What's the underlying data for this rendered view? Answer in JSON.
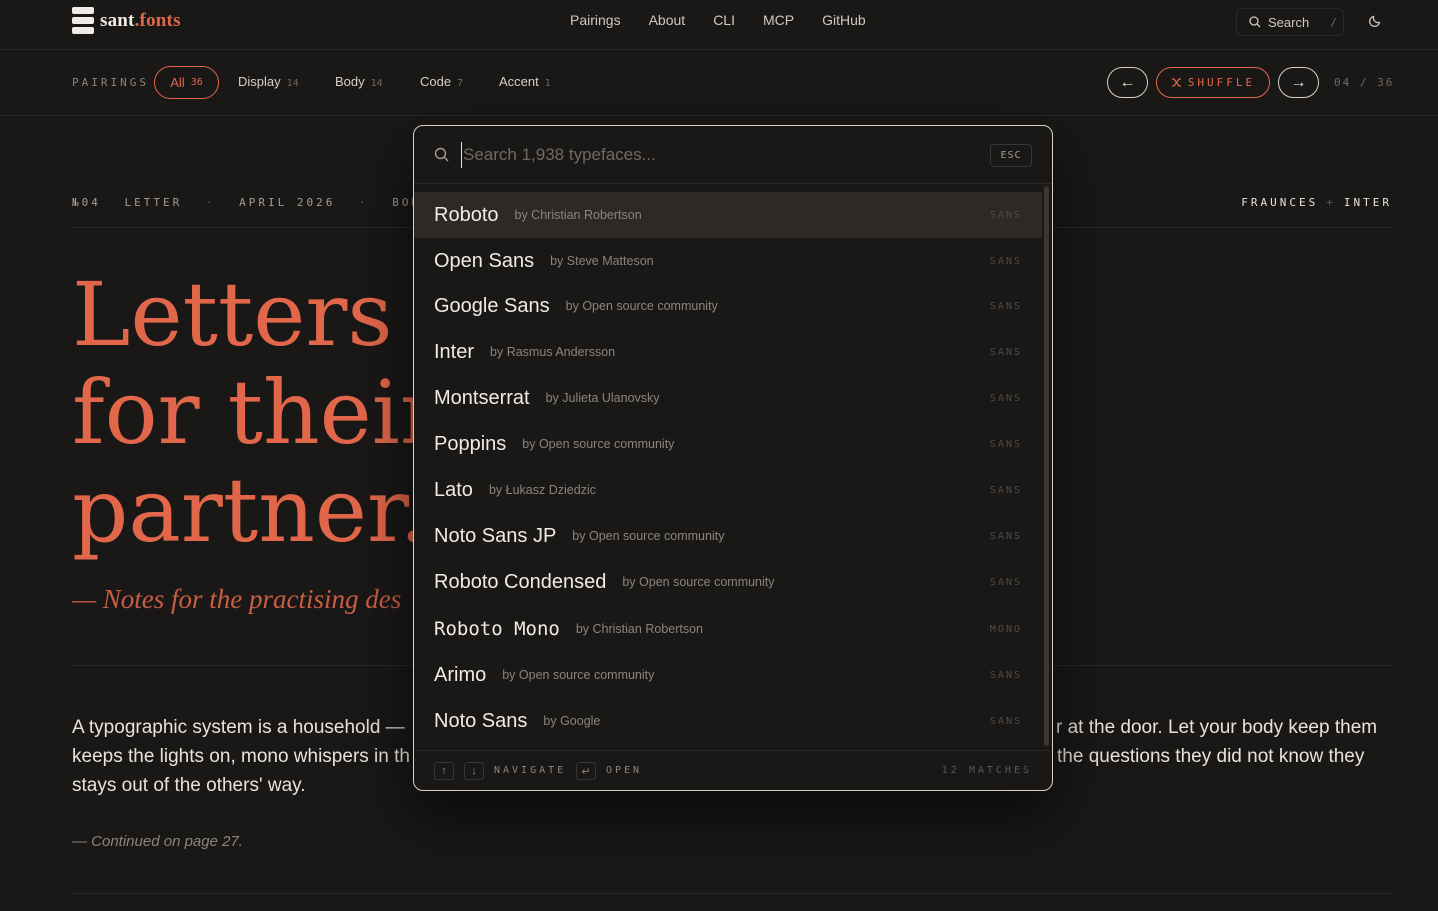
{
  "brand": {
    "name_main": "sant",
    "name_accent": ".fonts"
  },
  "nav": {
    "items": [
      "Pairings",
      "About",
      "CLI",
      "MCP",
      "GitHub"
    ]
  },
  "header_search": {
    "label": "Search",
    "shortcut": "/"
  },
  "icons": {
    "search": "search-icon",
    "theme": "moon-icon",
    "prev": "arrow-left-icon",
    "next": "arrow-right-icon",
    "shuffle": "shuffle-icon"
  },
  "colors": {
    "accent": "#e2674a",
    "background": "#1a1817",
    "text": "#e8e2da",
    "muted": "#8b847d"
  },
  "pairings": {
    "label": "PAIRINGS",
    "filters": [
      {
        "label": "All",
        "count": "36"
      },
      {
        "label": "Display",
        "count": "14"
      },
      {
        "label": "Body",
        "count": "14"
      },
      {
        "label": "Code",
        "count": "7"
      },
      {
        "label": "Accent",
        "count": "1"
      }
    ],
    "prev": "←",
    "next": "→",
    "shuffle": "SHUFFLE",
    "page": "04 / 36"
  },
  "article": {
    "meta": {
      "num": "№04",
      "kind": "LETTER",
      "date": "APRIL 2026",
      "pair_type": "BODY PAIR",
      "display_font": "FRAUNCES",
      "body_font": "INTER"
    },
    "headline": [
      "Letters l",
      "for their",
      "partner."
    ],
    "subhead": "— Notes for the practising des",
    "body_left": "A typographic system is a household —",
    "body_left2": "keeps the lights on, mono whispers in th",
    "body_right": "r at the door. Let your body keep them",
    "body_right2": "the questions they did not know they",
    "body_line3": "stays out of the others' way.",
    "continued": "— Continued on page 27."
  },
  "modal": {
    "placeholder": "Search 1,938 typefaces...",
    "esc": "ESC",
    "results": [
      {
        "name": "Roboto",
        "author": "by Christian Robertson",
        "tag": "SANS"
      },
      {
        "name": "Open Sans",
        "author": "by Steve Matteson",
        "tag": "SANS"
      },
      {
        "name": "Google Sans",
        "author": "by Open source community",
        "tag": "SANS"
      },
      {
        "name": "Inter",
        "author": "by Rasmus Andersson",
        "tag": "SANS"
      },
      {
        "name": "Montserrat",
        "author": "by Julieta Ulanovsky",
        "tag": "SANS"
      },
      {
        "name": "Poppins",
        "author": "by Open source community",
        "tag": "SANS"
      },
      {
        "name": "Lato",
        "author": "by Łukasz Dziedzic",
        "tag": "SANS"
      },
      {
        "name": "Noto Sans JP",
        "author": "by Open source community",
        "tag": "SANS"
      },
      {
        "name": "Roboto Condensed",
        "author": "by Open source community",
        "tag": "SANS"
      },
      {
        "name": "Roboto Mono",
        "author": "by Christian Robertson",
        "tag": "MONO"
      },
      {
        "name": "Arimo",
        "author": "by Open source community",
        "tag": "SANS"
      },
      {
        "name": "Noto Sans",
        "author": "by Google",
        "tag": "SANS"
      }
    ],
    "footer": {
      "up": "↑",
      "down": "↓",
      "navigate": "NAVIGATE",
      "enter": "↵",
      "open": "OPEN",
      "matches": "12 MATCHES"
    }
  }
}
